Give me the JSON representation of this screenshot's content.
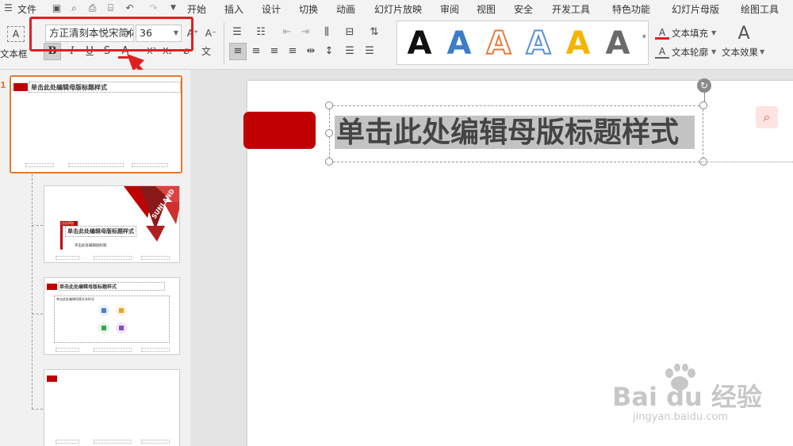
{
  "menubar": {
    "file_label": "文件",
    "tabs": [
      "开始",
      "插入",
      "设计",
      "切换",
      "动画",
      "幻灯片放映",
      "审阅",
      "视图",
      "安全",
      "开发工具",
      "特色功能",
      "幻灯片母版",
      "绘图工具"
    ]
  },
  "ribbon": {
    "textbox_label": "文本框",
    "font_name": "方正清刻本悦宋简体",
    "font_size": "36",
    "bold_label": "B",
    "italic_label": "I",
    "underline_label": "U",
    "strike_label": "S",
    "fontcolor_label": "A",
    "superscript_label": "X²",
    "subscript_label": "X₂",
    "grow_label": "A⁺",
    "shrink_label": "A⁻",
    "wen_label": "文",
    "text_fill_label": "文本填充",
    "text_outline_label": "文本轮廓",
    "text_effect_label": "文本效果",
    "wordart_glyph": "A",
    "wordart_colors": [
      "#111111",
      "#3d7cc9",
      "#e67a3a",
      "#5b8fd6",
      "#f5b400",
      "#6a6a6a"
    ]
  },
  "thumbnails": {
    "slide_number": "1",
    "master_title": "单击此处编辑母版标题样式",
    "slide2_title": "单击此处编辑母版标题样式",
    "slide2_subtitle": "单击此处编辑副标题",
    "slide2_tag": "点击添加",
    "slide2_brand": "SUNLAND",
    "slide3_title": "单击此处编辑母版标题样式",
    "slide3_body": "单击此处编辑母版文本样式"
  },
  "slide": {
    "title": "单击此处编辑母版标题样式",
    "accent_color": "#c00000"
  },
  "watermark": {
    "brand": "Bai  du 经验",
    "url": "jingyan.baidu.com"
  }
}
